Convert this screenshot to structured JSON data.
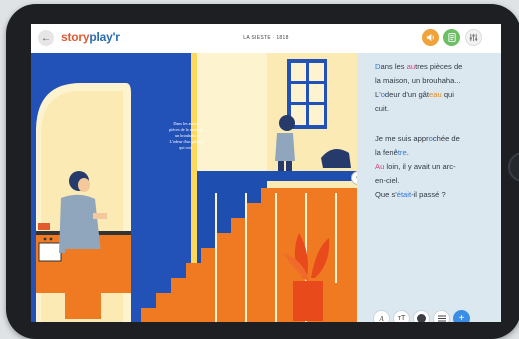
{
  "header": {
    "brand_part1": "story",
    "brand_part2": "play'r",
    "book_title": "LA SIESTE · 1818",
    "back_icon": "arrow-left-icon",
    "sound_icon": "speaker-icon",
    "pages_icon": "document-icon",
    "settings_icon": "sliders-icon"
  },
  "illustration": {
    "caption": [
      "Dans les autres",
      "pièces de la maison,",
      "un brouhaha.",
      "L'odeur d'un gâteau",
      "qui cuit."
    ]
  },
  "text_pane": {
    "paragraph1": [
      [
        {
          "t": "D",
          "c": "hb"
        },
        {
          "t": "ans les "
        },
        {
          "t": "au",
          "c": "hp"
        },
        {
          "t": "tres pièces de"
        }
      ],
      [
        {
          "t": "la maison, un brouhaha..."
        }
      ],
      [
        {
          "t": "L'"
        },
        {
          "t": "o",
          "c": "hb"
        },
        {
          "t": "deur d'un gât"
        },
        {
          "t": "eau",
          "c": "ho"
        },
        {
          "t": " qui"
        }
      ],
      [
        {
          "t": "cuit."
        }
      ]
    ],
    "paragraph2": [
      [
        {
          "t": "Je me suis appr"
        },
        {
          "t": "o",
          "c": "hb"
        },
        {
          "t": "chée de"
        }
      ],
      [
        {
          "t": "la fenê"
        },
        {
          "t": "tre",
          "c": "hb"
        },
        {
          "t": "."
        }
      ],
      [
        {
          "t": "Au",
          "c": "hp"
        },
        {
          "t": " loin, il y avait un arc-"
        }
      ],
      [
        {
          "t": "en-ciel."
        }
      ],
      [
        {
          "t": "Que s'"
        },
        {
          "t": "était",
          "c": "hb"
        },
        {
          "t": "-il passé ?"
        }
      ]
    ]
  },
  "tools": {
    "font_icon": "font-style-icon",
    "size_label": "тT",
    "color_icon": "color-dot-icon",
    "menu_icon": "list-icon",
    "add_label": "+"
  },
  "colors": {
    "brand_orange": "#e05a34",
    "brand_blue": "#2b6cb0",
    "wall_blue": "#1e4fb0",
    "stair_orange": "#f07a22",
    "cream": "#fdf3cf"
  }
}
